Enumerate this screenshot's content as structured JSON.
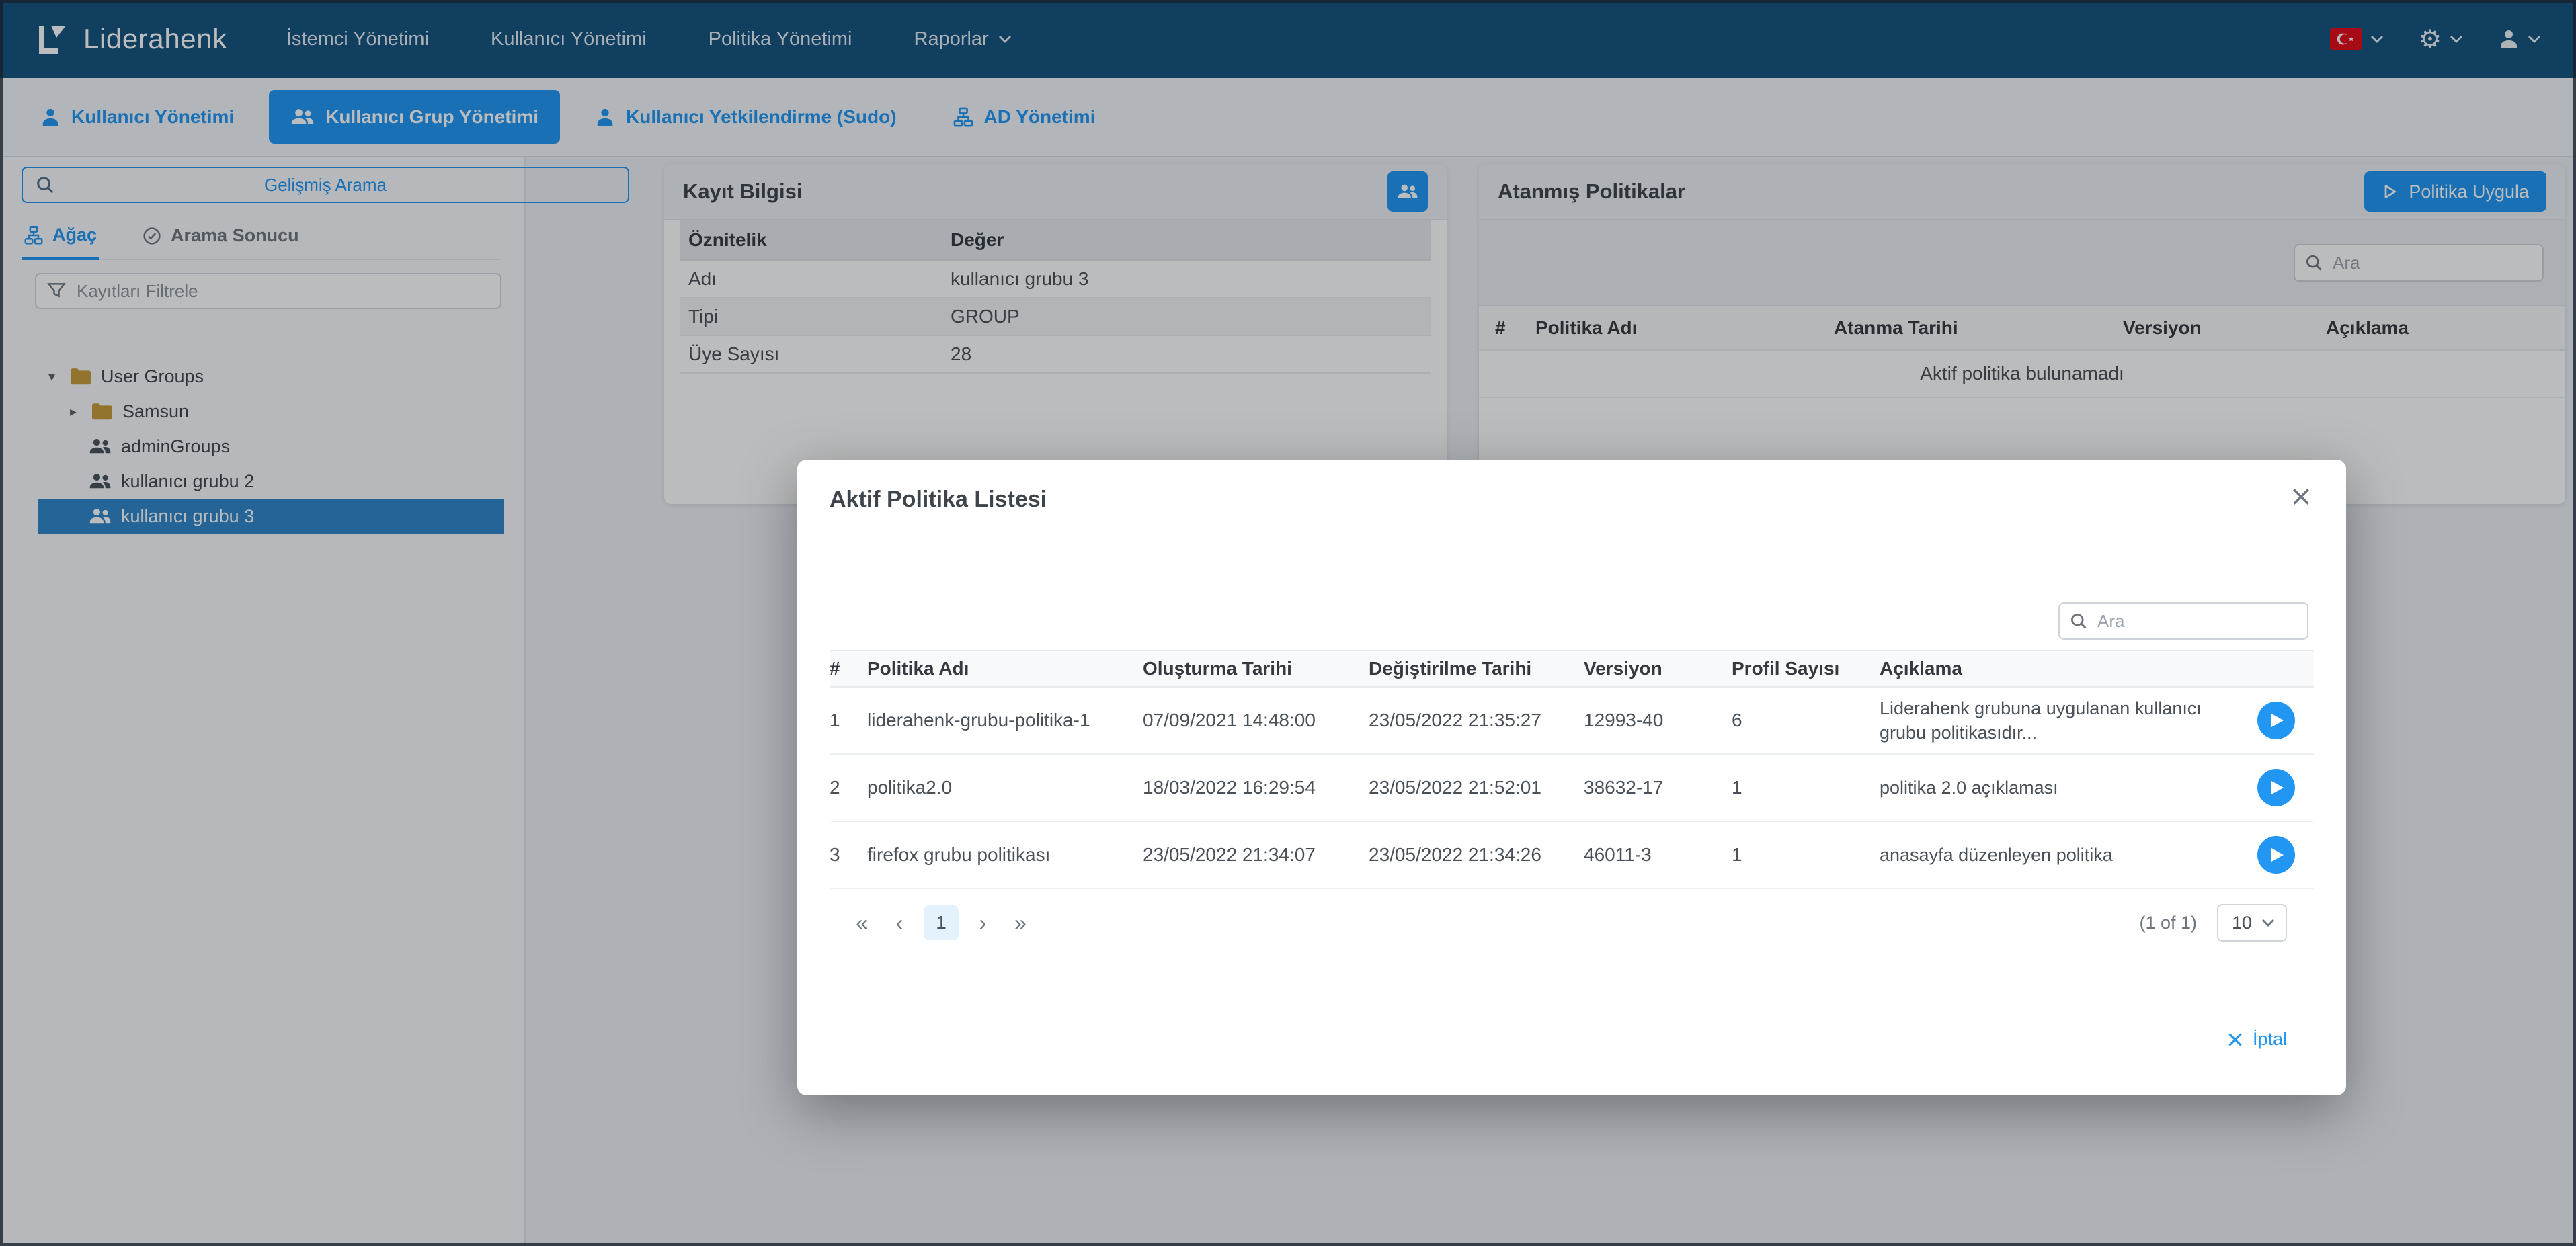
{
  "colors": {
    "primary": "#2196F3",
    "navbar_bg": "#14527e",
    "tree_selected_bg": "#2f86cb",
    "flag_red": "#e30a17",
    "page_bg": "#eef2f7"
  },
  "navbar": {
    "logo_text": "Liderahenk",
    "menu": [
      {
        "label": "İstemci Yönetimi"
      },
      {
        "label": "Kullanıcı Yönetimi"
      },
      {
        "label": "Politika Yönetimi"
      },
      {
        "label": "Raporlar"
      }
    ]
  },
  "tabbar": {
    "tabs": [
      {
        "label": "Kullanıcı Yönetimi"
      },
      {
        "label": "Kullanıcı Grup Yönetimi"
      },
      {
        "label": "Kullanıcı Yetkilendirme (Sudo)"
      },
      {
        "label": "AD Yönetimi"
      }
    ]
  },
  "sidebar": {
    "advanced_search_label": "Gelişmiş Arama",
    "tree_tab": "Ağaç",
    "search_result_tab": "Arama Sonucu",
    "filter_placeholder": "Kayıtları Filtrele",
    "tree": [
      {
        "label": "User Groups"
      },
      {
        "label": "Samsun"
      },
      {
        "label": "adminGroups"
      },
      {
        "label": "kullanıcı grubu 2"
      },
      {
        "label": "kullanıcı grubu 3"
      }
    ]
  },
  "record_card": {
    "title": "Kayıt Bilgisi",
    "headers": {
      "attribute": "Öznitelik",
      "value": "Değer"
    },
    "rows": [
      {
        "attribute": "Adı",
        "value": "kullanıcı grubu 3"
      },
      {
        "attribute": "Tipi",
        "value": "GROUP"
      },
      {
        "attribute": "Üye Sayısı",
        "value": "28"
      }
    ]
  },
  "policies_card": {
    "title": "Atanmış Politikalar",
    "apply_button_label": "Politika Uygula",
    "search_placeholder": "Ara",
    "headers": [
      "#",
      "Politika Adı",
      "Atanma Tarihi",
      "Versiyon",
      "Açıklama"
    ],
    "empty_message": "Aktif politika bulunamadı"
  },
  "modal": {
    "title": "Aktif Politika Listesi",
    "search_placeholder": "Ara",
    "headers": [
      "#",
      "Politika Adı",
      "Oluşturma Tarihi",
      "Değiştirilme Tarihi",
      "Versiyon",
      "Profil Sayısı",
      "Açıklama"
    ],
    "rows": [
      {
        "index": "1",
        "name": "liderahenk-grubu-politika-1",
        "created": "07/09/2021 14:48:00",
        "modified": "23/05/2022 21:35:27",
        "version": "12993-40",
        "profile_count": "6",
        "description": "Liderahenk grubuna uygulanan kullanıcı grubu politikasıdır..."
      },
      {
        "index": "2",
        "name": "politika2.0",
        "created": "18/03/2022 16:29:54",
        "modified": "23/05/2022 21:52:01",
        "version": "38632-17",
        "profile_count": "1",
        "description": "politika 2.0 açıklaması"
      },
      {
        "index": "3",
        "name": "firefox grubu politikası",
        "created": "23/05/2022 21:34:07",
        "modified": "23/05/2022 21:34:26",
        "version": "46011-3",
        "profile_count": "1",
        "description": "anasayfa düzenleyen politika"
      }
    ],
    "pagination": {
      "first": "«",
      "prev": "‹",
      "page": "1",
      "next": "›",
      "last": "»",
      "report": "(1 of 1)",
      "rows_per_page": "10"
    },
    "cancel_label": "İptal"
  },
  "icons": {
    "search-icon": "magnifier",
    "filter-icon": "funnel",
    "tree-icon": "sitemap",
    "check-circle-icon": "check in circle",
    "folder-icon": "folder",
    "group-icon": "two-person group",
    "user-icon": "person silhouette",
    "sitemap-icon": "hierarchy nodes",
    "play-icon": "play triangle",
    "close-icon": "x cross",
    "gear-icon": "⚙",
    "turkey-flag-icon": "turkish flag",
    "caret-down": "▾",
    "caret-right": "▸",
    "chevron-down-icon": "⌄"
  }
}
